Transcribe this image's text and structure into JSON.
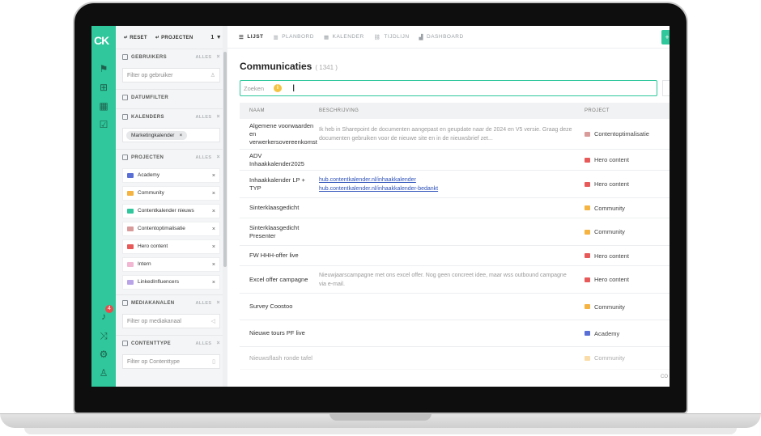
{
  "rail": {
    "logo": "CK",
    "badge": "4"
  },
  "filters": {
    "reset_label": "RESET",
    "projecten_label": "PROJECTEN",
    "count": "1",
    "alles": "ALLES",
    "gebruikers": {
      "title": "GEBRUIKERS",
      "placeholder": "Filter op gebruiker"
    },
    "datumfilter": {
      "title": "DATUMFILTER"
    },
    "kalenders": {
      "title": "KALENDERS",
      "chip": "Marketingkalender"
    },
    "projecten": {
      "title": "PROJECTEN",
      "items": [
        {
          "label": "Academy",
          "color": "#5a6fd6"
        },
        {
          "label": "Community",
          "color": "#f5b342"
        },
        {
          "label": "Contentkalender nieuws",
          "color": "#2fc79b"
        },
        {
          "label": "Contentoptimalisatie",
          "color": "#d99a9a"
        },
        {
          "label": "Hero content",
          "color": "#e85a5a"
        },
        {
          "label": "Intern",
          "color": "#f2b7d3"
        },
        {
          "label": "LinkedInfluencers",
          "color": "#b9a4e8"
        }
      ]
    },
    "mediakanalen": {
      "title": "MEDIAKANALEN",
      "placeholder": "Filter op mediakanaal"
    },
    "contenttype": {
      "title": "CONTENTTYPE",
      "placeholder": "Filter op Contenttype"
    }
  },
  "tabs": [
    {
      "label": "LIJST",
      "icon": "list-icon",
      "active": true
    },
    {
      "label": "PLANBORD",
      "icon": "board-icon"
    },
    {
      "label": "KALENDER",
      "icon": "calendar-icon"
    },
    {
      "label": "TIJDLIJN",
      "icon": "timeline-icon"
    },
    {
      "label": "DASHBOARD",
      "icon": "dashboard-icon"
    }
  ],
  "page": {
    "title": "Communicaties",
    "count": "( 1341 )",
    "search_placeholder": "Zoeken"
  },
  "table": {
    "headers": {
      "name": "NAAM",
      "desc": "BESCHRIJVING",
      "project": "PROJECT"
    },
    "rows": [
      {
        "name": "Algemene voorwaarden en verwerkersovereenkomst",
        "desc": "Ik heb in Sharepoint de documenten aangepast en geupdate naar de 2024 en V5 versie. Graag deze documenten gebruiken voor de nieuwe site en in de nieuwsbrief zet...",
        "project": "Contentoptimalisatie",
        "color": "#d99a9a",
        "h": 38
      },
      {
        "name": "ADV Inhaakkalender2025",
        "desc": "",
        "project": "Hero content",
        "color": "#e85a5a",
        "h": 26
      },
      {
        "name": "Inhaakkalender LP + TYP",
        "links": [
          "hub.contentkalender.nl/inhaakkalender",
          "hub.contentkalender.nl/inhaakkalender-bedankt"
        ],
        "project": "Hero content",
        "color": "#e85a5a",
        "h": 34
      },
      {
        "name": "Sinterklaasgedicht",
        "desc": "",
        "project": "Community",
        "color": "#f5b342",
        "h": 25
      },
      {
        "name": "Sinterklaasgedicht Presenter",
        "desc": "",
        "project": "Community",
        "color": "#f5b342",
        "h": 34
      },
      {
        "name": "FW HHH-offer live",
        "desc": "",
        "project": "Hero content",
        "color": "#e85a5a",
        "h": 25
      },
      {
        "name": "Excel offer campagne",
        "desc": "Nieuwjaarscampagne met ons excel offer. Nog geen concreet idee, maar wss outbound campagne via e-mail.",
        "project": "Hero content",
        "color": "#e85a5a",
        "h": 34
      },
      {
        "name": "Survey Coostoo",
        "desc": "",
        "project": "Community",
        "color": "#f5b342",
        "h": 33
      },
      {
        "name": "Nieuwe tours PF live",
        "desc": "",
        "project": "Academy",
        "color": "#5a6fd6",
        "h": 33
      },
      {
        "name": "Nieuwsflash ronde tafel",
        "desc": "",
        "project": "Community",
        "color": "#f5b342",
        "h": 28,
        "faded": true
      }
    ]
  },
  "corner_text": "CO"
}
